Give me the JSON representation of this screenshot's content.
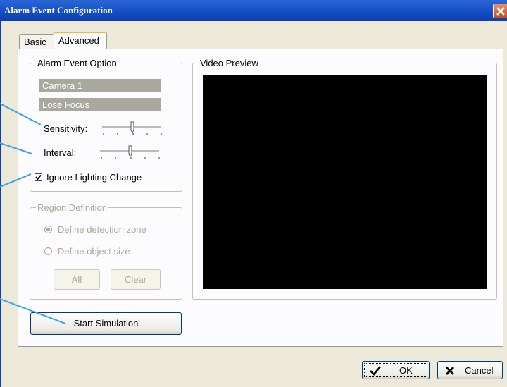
{
  "window": {
    "title": "Alarm Event Configuration"
  },
  "tabs": {
    "basic": "Basic",
    "advanced": "Advanced"
  },
  "alarm_option": {
    "group_label": "Alarm Event Option",
    "camera": "Camera 1",
    "event": "Lose Focus",
    "sensitivity_label": "Sensitivity:",
    "sensitivity_level": 0.5,
    "interval_label": "Interval:",
    "interval_level": 0.5,
    "ignore_lighting_label": "Ignore Lighting Change",
    "ignore_lighting_checked": true
  },
  "region": {
    "group_label": "Region Definition",
    "detection_zone": "Define detection zone",
    "object_size": "Define object size",
    "all_button": "All",
    "clear_button": "Clear"
  },
  "video_preview": {
    "group_label": "Video Preview"
  },
  "buttons": {
    "start_simulation": "Start Simulation",
    "ok": "OK",
    "cancel": "Cancel"
  },
  "colors": {
    "title_bar": "#1049be",
    "annotation_line": "#3aa0e8",
    "video_bg": "#000000"
  }
}
